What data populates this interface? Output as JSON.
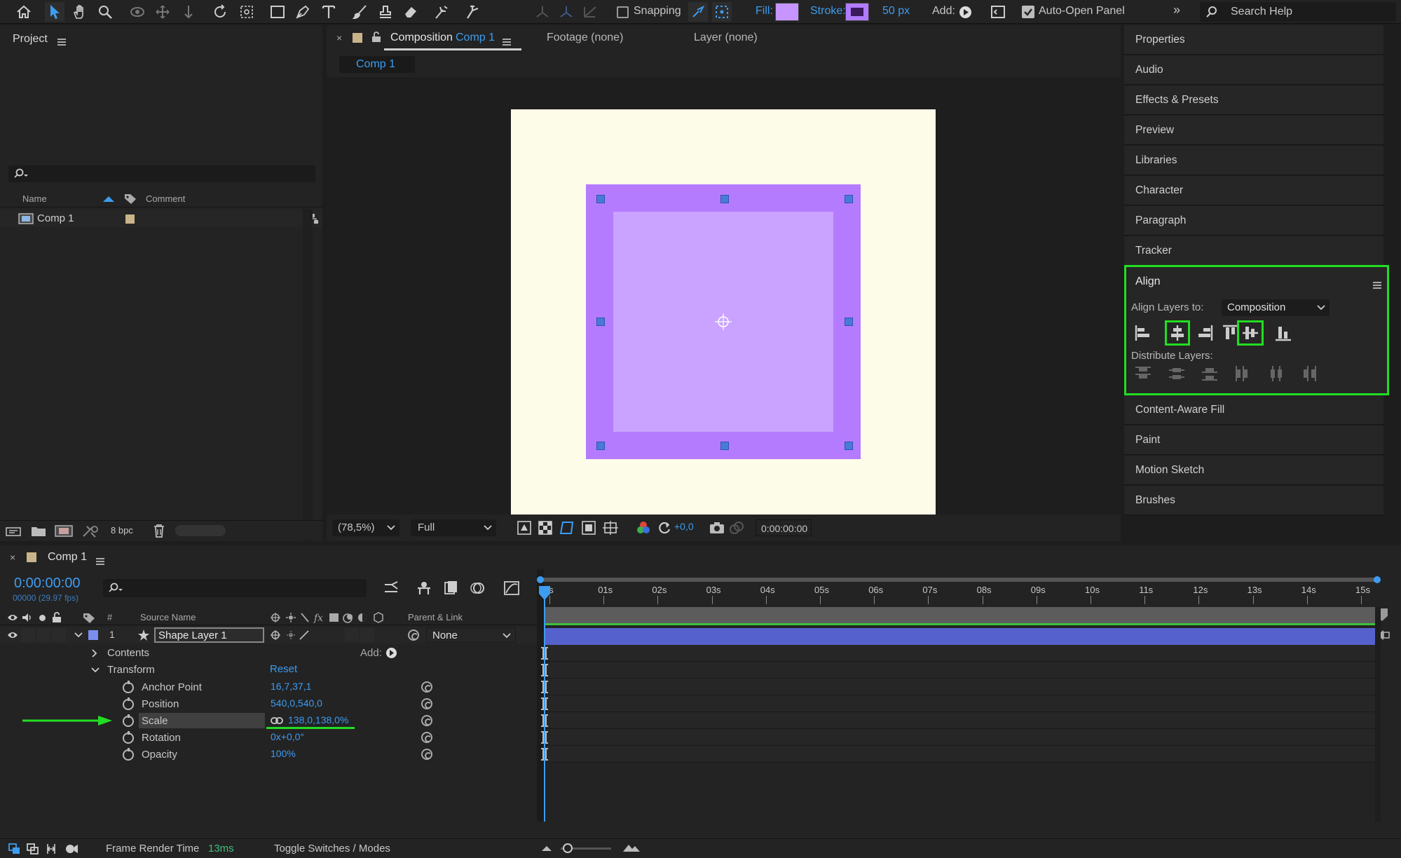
{
  "toolbar": {
    "snapping": "Snapping",
    "fill": "Fill:",
    "stroke": "Stroke:",
    "stroke_width": "50 px",
    "add": "Add:",
    "auto_open": "Auto-Open Panel",
    "search": "Search Help",
    "fill_color": "#c795ff",
    "stroke_color": "#5a2a8a"
  },
  "project": {
    "title": "Project",
    "col_name": "Name",
    "col_comment": "Comment",
    "items": [
      {
        "name": "Comp 1"
      }
    ],
    "bpc": "8 bpc"
  },
  "viewer": {
    "tab_title": "Composition",
    "tab_comp": "Comp 1",
    "footage": "Footage (none)",
    "layer": "Layer (none)",
    "comp_subtab": "Comp 1",
    "zoom": "(78,5%)",
    "resolution": "Full",
    "exposure": "+0,0",
    "timecode": "0:00:00:00",
    "canvas_bg": "#fdfce9",
    "shape_outer": "#b57bff",
    "shape_inner": "#c9a3ff"
  },
  "side": {
    "items_top": [
      "Properties",
      "Audio",
      "Effects & Presets",
      "Preview",
      "Libraries",
      "Character",
      "Paragraph",
      "Tracker"
    ],
    "align": {
      "title": "Align",
      "align_to_label": "Align Layers to:",
      "align_to_value": "Composition",
      "distribute_label": "Distribute Layers:"
    },
    "items_bottom": [
      "Content-Aware Fill",
      "Paint",
      "Motion Sketch",
      "Brushes"
    ]
  },
  "timeline": {
    "tab": "Comp 1",
    "timecode": "0:00:00:00",
    "fps": "00000 (29.97 fps)",
    "col_num": "#",
    "col_source": "Source Name",
    "col_parent": "Parent & Link",
    "layer": {
      "num": "1",
      "name": "Shape Layer 1",
      "parent": "None"
    },
    "contents": "Contents",
    "add": "Add:",
    "transform": "Transform",
    "reset": "Reset",
    "props": [
      {
        "name": "Anchor Point",
        "value": "16,7,37,1"
      },
      {
        "name": "Position",
        "value": "540,0,540,0"
      },
      {
        "name": "Scale",
        "value": "138,0,138,0%"
      },
      {
        "name": "Rotation",
        "value": "0x+0,0°"
      },
      {
        "name": "Opacity",
        "value": "100%"
      }
    ],
    "ruler": [
      "0s",
      "01s",
      "02s",
      "03s",
      "04s",
      "05s",
      "06s",
      "07s",
      "08s",
      "09s",
      "10s",
      "11s",
      "12s",
      "13s",
      "14s",
      "15s"
    ],
    "frame_render_label": "Frame Render Time",
    "frame_render_value": "13ms",
    "toggle": "Toggle Switches / Modes"
  }
}
